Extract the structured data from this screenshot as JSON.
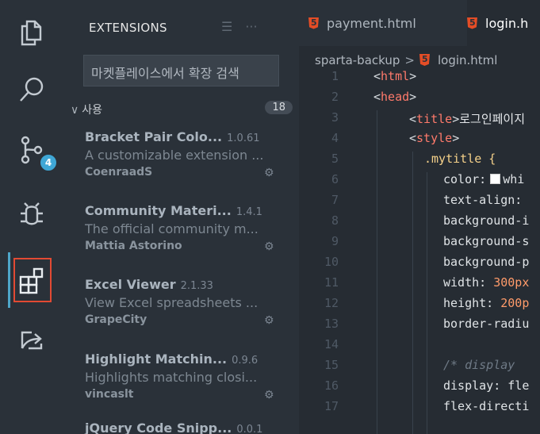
{
  "activity_bar": [
    {
      "id": "explorer",
      "icon": "files-icon"
    },
    {
      "id": "search",
      "icon": "search-icon"
    },
    {
      "id": "source_control",
      "icon": "source-control-icon",
      "badge": "4"
    },
    {
      "id": "debug",
      "icon": "debug-icon"
    },
    {
      "id": "extensions",
      "icon": "extensions-icon",
      "active": true
    },
    {
      "id": "live_share",
      "icon": "live-share-icon"
    }
  ],
  "sidebar": {
    "title": "EXTENSIONS",
    "header_icons": [
      "filter-list-icon",
      "more-icon"
    ],
    "search_placeholder": "마켓플레이스에서 확장 검색",
    "group": {
      "label": "사용",
      "count": "18"
    },
    "extensions": [
      {
        "name": "Bracket Pair Colo...",
        "version": "1.0.61",
        "description": "A customizable extension ...",
        "publisher": "CoenraadS"
      },
      {
        "name": "Community Materi...",
        "version": "1.4.1",
        "description": "The official community m...",
        "publisher": "Mattia Astorino"
      },
      {
        "name": "Excel Viewer",
        "version": "2.1.33",
        "description": "View Excel spreadsheets ...",
        "publisher": "GrapeCity"
      },
      {
        "name": "Highlight Matchin...",
        "version": "0.9.6",
        "description": "Highlights matching closi...",
        "publisher": "vincaslt"
      },
      {
        "name": "jQuery Code Snipp...",
        "version": "0.0.1",
        "description": "",
        "publisher": ""
      }
    ]
  },
  "tabs": [
    {
      "label": "payment.html",
      "active": false
    },
    {
      "label": "login.h",
      "active": true
    }
  ],
  "breadcrumb": {
    "folder": "sparta-backup",
    "file": "login.html"
  },
  "code": {
    "line_numbers": [
      "1",
      "2",
      "3",
      "4",
      "5",
      "6",
      "7",
      "8",
      "9",
      "10",
      "11",
      "12",
      "13",
      "14",
      "15",
      "16",
      "17"
    ],
    "lines": {
      "l1_tag": "html",
      "l2_tag": "head",
      "l3_tag": "title",
      "l3_text": "로그인페이지",
      "l4_tag": "style",
      "l5_selector": ".mytitle {",
      "l6_prop": "color:",
      "l6_val": "whi",
      "l7_prop": "text-align:",
      "l8_prop": "background-i",
      "l9_prop": "background-s",
      "l10_prop": "background-p",
      "l11_prop": "width:",
      "l11_val": "300px",
      "l12_prop": "height:",
      "l12_val": "200p",
      "l13_prop": "border-radiu",
      "l15_comment": "/* display",
      "l16_prop": "display:",
      "l16_val": "fle",
      "l17_prop": "flex-directi"
    }
  },
  "colors": {
    "accent": "#4ea6c9",
    "highlight_box": "#e24a33",
    "tag": "#ff7a6b",
    "selector": "#f5d18a",
    "number": "#ff9b6a"
  }
}
